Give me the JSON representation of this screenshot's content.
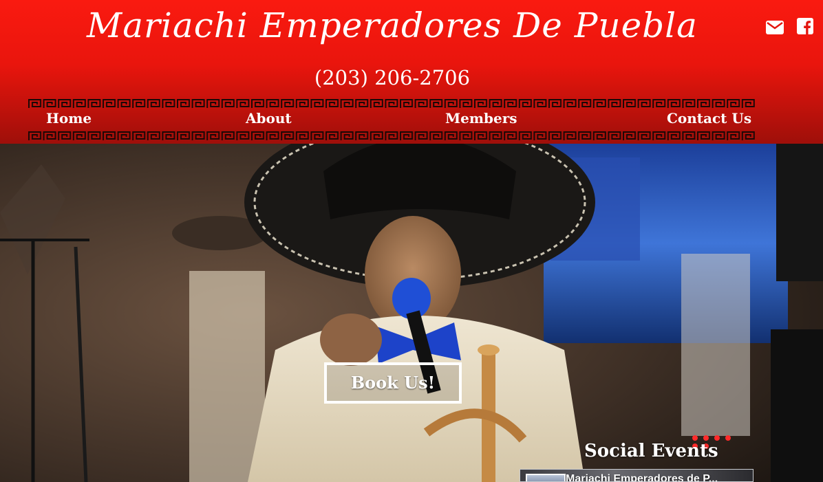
{
  "header": {
    "title": "Mariachi Emperadores De Puebla",
    "phone": "(203) 206-2706",
    "icons": [
      "envelope-icon",
      "facebook-icon"
    ],
    "colors": {
      "top": "#fa1a10",
      "bottom": "#9e0f0a"
    }
  },
  "nav": {
    "items": [
      {
        "label": "Home"
      },
      {
        "label": "About"
      },
      {
        "label": "Members"
      },
      {
        "label": "Contact Us"
      }
    ]
  },
  "hero": {
    "cta_label": "Book Us!"
  },
  "social": {
    "title": "Social Events",
    "fb_page_name": "Mariachi Emperadores de P..."
  }
}
